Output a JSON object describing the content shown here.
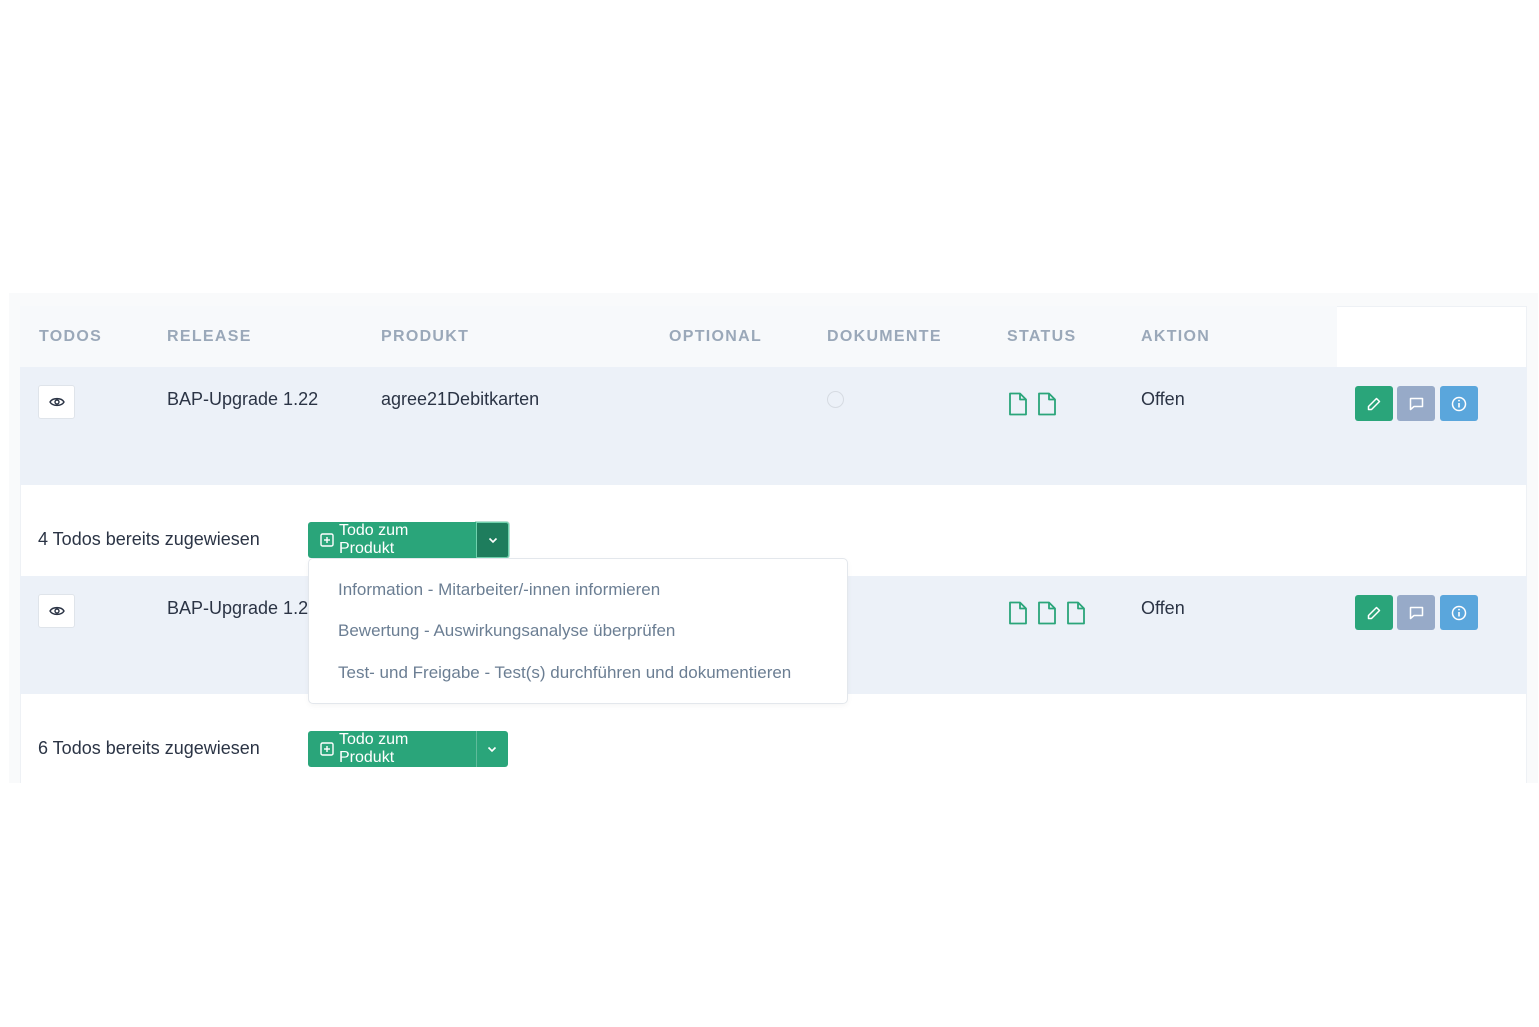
{
  "table": {
    "headers": [
      "TODOS",
      "RELEASE",
      "PRODUKT",
      "OPTIONAL",
      "DOKUMENTE",
      "STATUS",
      "AKTION"
    ],
    "rows": [
      {
        "release": "BAP-Upgrade 1.22",
        "product": "agree21Debitkarten",
        "optional_selected": false,
        "document_count": 2,
        "status": "Offen",
        "assigned_text": "4 Todos bereits zugewiesen",
        "todo_button_label": "Todo zum Produkt"
      },
      {
        "release": "BAP-Upgrade 1.2",
        "product": "",
        "document_count": 3,
        "status": "Offen",
        "assigned_text": "6 Todos bereits zugewiesen",
        "todo_button_label": "Todo zum Produkt"
      }
    ]
  },
  "dropdown": {
    "open": true,
    "items": [
      "Information - Mitarbeiter/-innen informieren",
      "Bewertung - Auswirkungsanalyse überprüfen",
      "Test- und Freigabe - Test(s) durchführen und dokumentieren"
    ]
  },
  "icons": {
    "view": "eye-icon",
    "document": "file-icon",
    "edit": "pencil-icon",
    "comment": "comment-icon",
    "info": "info-icon",
    "add": "plus-square-icon",
    "dropdown": "chevron-down-icon"
  },
  "colors": {
    "primary_green": "#2aa57a",
    "comment_gray_blue": "#97aac8",
    "info_blue": "#5aa6dc",
    "row_background": "#ecf1f8",
    "header_text": "#9aa8b9"
  }
}
